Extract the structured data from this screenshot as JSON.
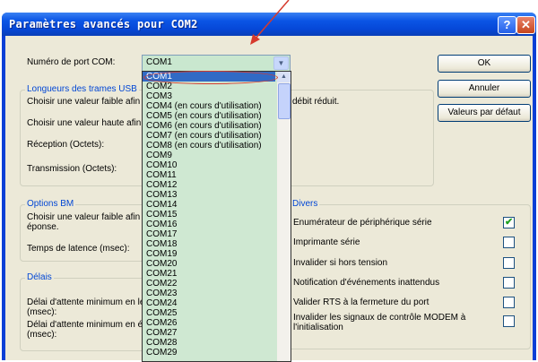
{
  "window": {
    "title": "Paramètres avancés pour COM2",
    "help_glyph": "?",
    "close_glyph": "✕"
  },
  "port": {
    "label": "Numéro de port COM:",
    "value": "COM1"
  },
  "buttons": {
    "ok": "OK",
    "cancel": "Annuler",
    "defaults": "Valeurs par défaut"
  },
  "usb_group": {
    "title": "Longueurs des trames USB",
    "low_text": "Choisir une valeur faible afin",
    "low_text_tail": "débit réduit.",
    "high_text": "Choisir une valeur haute afin",
    "reception": "Réception (Octets):",
    "transmission": "Transmission (Octets):"
  },
  "bm_group": {
    "title": "Options BM",
    "low_text": "Choisir une valeur faible afin",
    "low_text_line2": "éponse.",
    "latency": "Temps de latence (msec):"
  },
  "delays_group": {
    "title": "Délais",
    "min1_line1": "Délai d'attente minimum en le",
    "min1_line2": "(msec):",
    "min2_line1": "Délai d'attente minimum en é",
    "min2_line2": "(msec):"
  },
  "misc_group": {
    "title": "Divers",
    "options": [
      {
        "label": "Enumérateur de périphérique série",
        "checked": true
      },
      {
        "label": "Imprimante série",
        "checked": false
      },
      {
        "label": "Invalider si hors tension",
        "checked": false
      },
      {
        "label": "Notification d'événements inattendus",
        "checked": false
      },
      {
        "label": "Valider RTS à la fermeture du port",
        "checked": false
      },
      {
        "label": "Invalider les signaux de contrôle MODEM à",
        "label2": "l'initialisation",
        "checked": false
      }
    ]
  },
  "dropdown_items": [
    "COM1",
    "COM2",
    "COM3",
    "COM4 (en cours d'utilisation)",
    "COM5 (en cours d'utilisation)",
    "COM6 (en cours d'utilisation)",
    "COM7 (en cours d'utilisation)",
    "COM8 (en cours d'utilisation)",
    "COM9",
    "COM10",
    "COM11",
    "COM12",
    "COM13",
    "COM14",
    "COM15",
    "COM16",
    "COM17",
    "COM18",
    "COM19",
    "COM20",
    "COM21",
    "COM22",
    "COM23",
    "COM24",
    "COM25",
    "COM26",
    "COM27",
    "COM28",
    "COM29"
  ],
  "selected_item": "COM1",
  "colors": {
    "annotation": "#d63a2d",
    "list_bg": "#cfe8d2",
    "selection": "#316ac5",
    "group_title": "#0046d5"
  }
}
